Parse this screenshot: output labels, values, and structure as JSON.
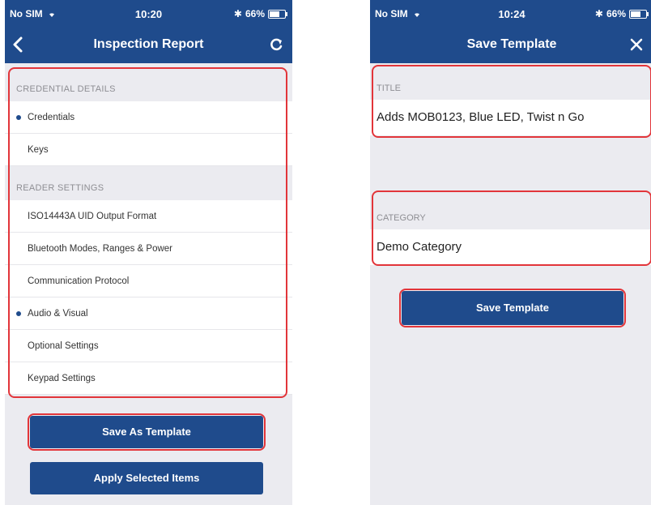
{
  "colors": {
    "nav": "#1f4b8c",
    "highlight": "#e2353a",
    "background": "#ebebf0"
  },
  "left": {
    "status": {
      "carrier": "No SIM",
      "time": "10:20",
      "battery": "66%",
      "battery_level": 0.66
    },
    "nav": {
      "title": "Inspection Report",
      "back_icon": "chevron-left-icon",
      "refresh_icon": "refresh-icon"
    },
    "credential_section": {
      "header": "CREDENTIAL DETAILS",
      "items": [
        {
          "label": "Credentials",
          "selected": true
        },
        {
          "label": "Keys",
          "selected": false
        }
      ]
    },
    "reader_section": {
      "header": "READER SETTINGS",
      "items": [
        {
          "label": "ISO14443A UID Output Format",
          "selected": false
        },
        {
          "label": "Bluetooth Modes, Ranges & Power",
          "selected": false
        },
        {
          "label": "Communication Protocol",
          "selected": false
        },
        {
          "label": "Audio & Visual",
          "selected": true
        },
        {
          "label": "Optional Settings",
          "selected": false
        },
        {
          "label": "Keypad Settings",
          "selected": false
        }
      ]
    },
    "buttons": {
      "save_as_template": "Save As Template",
      "apply_selected": "Apply Selected Items"
    }
  },
  "right": {
    "status": {
      "carrier": "No SIM",
      "time": "10:24",
      "battery": "66%",
      "battery_level": 0.66
    },
    "nav": {
      "title": "Save Template",
      "close_icon": "close-icon"
    },
    "title_field": {
      "label": "TITLE",
      "value": "Adds MOB0123, Blue LED, Twist n Go"
    },
    "category_field": {
      "label": "CATEGORY",
      "value": "Demo Category"
    },
    "buttons": {
      "save_template": "Save Template"
    }
  }
}
